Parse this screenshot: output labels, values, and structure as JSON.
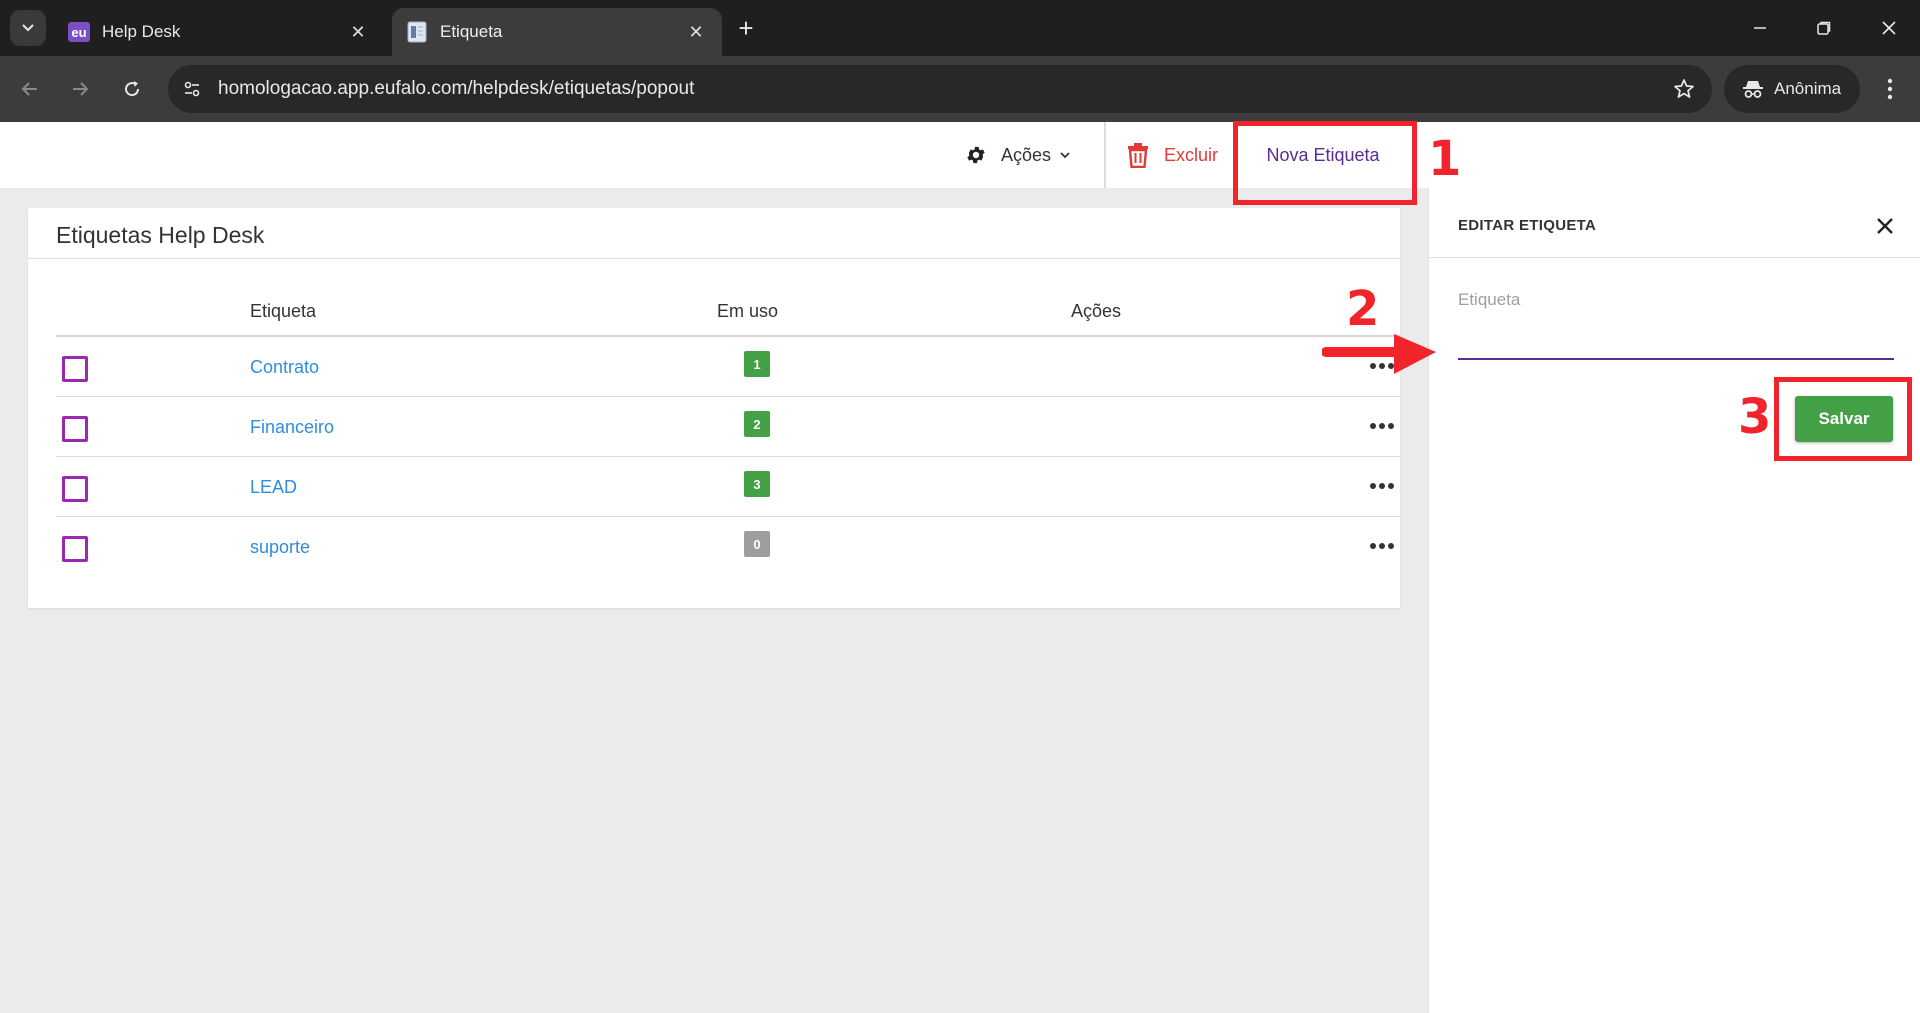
{
  "browser": {
    "tabs": [
      {
        "title": "Help Desk",
        "favicon": "eu",
        "active": false
      },
      {
        "title": "Etiqueta",
        "favicon": "document-icon",
        "active": true
      }
    ],
    "url": "homologacao.app.eufalo.com/helpdesk/etiquetas/popout",
    "profile_label": "Anônima"
  },
  "appbar": {
    "actions_label": "Ações",
    "delete_label": "Excluir",
    "new_label": "Nova Etiqueta"
  },
  "card": {
    "title": "Etiquetas Help Desk",
    "columns": [
      "Etiqueta",
      "Em uso",
      "Ações"
    ],
    "rows": [
      {
        "tag": "Contrato",
        "count": "1",
        "count_color": "#43a047"
      },
      {
        "tag": "Financeiro",
        "count": "2",
        "count_color": "#43a047"
      },
      {
        "tag": "LEAD",
        "count": "3",
        "count_color": "#43a047"
      },
      {
        "tag": "suporte",
        "count": "0",
        "count_color": "#9e9e9e"
      }
    ]
  },
  "panel": {
    "title": "EDITAR ETIQUETA",
    "field_label": "Etiqueta",
    "field_value": "",
    "save_label": "Salvar"
  },
  "annotations": [
    "1",
    "2",
    "3"
  ],
  "colors": {
    "accent_purple": "#5c2b91",
    "danger_red": "#e53935",
    "save_green": "#43a047",
    "link_blue": "#2f8ddd",
    "annotation_red": "#f0242a"
  }
}
